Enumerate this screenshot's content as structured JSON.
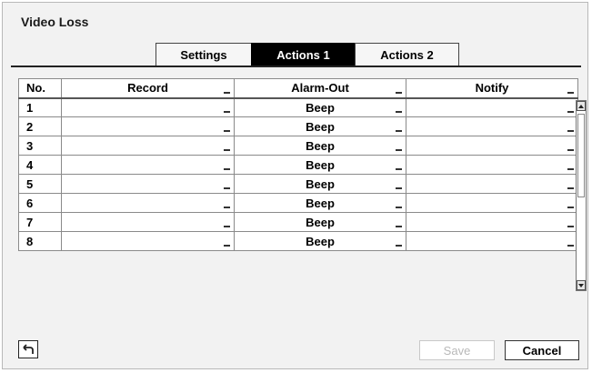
{
  "dialog": {
    "title": "Video Loss"
  },
  "tabs": [
    {
      "label": "Settings",
      "active": false
    },
    {
      "label": "Actions 1",
      "active": true
    },
    {
      "label": "Actions 2",
      "active": false
    }
  ],
  "table": {
    "columns": [
      "No.",
      "Record",
      "Alarm-Out",
      "Notify"
    ],
    "rows": [
      {
        "no": "1",
        "record": "",
        "alarm_out": "Beep",
        "notify": ""
      },
      {
        "no": "2",
        "record": "",
        "alarm_out": "Beep",
        "notify": ""
      },
      {
        "no": "3",
        "record": "",
        "alarm_out": "Beep",
        "notify": ""
      },
      {
        "no": "4",
        "record": "",
        "alarm_out": "Beep",
        "notify": ""
      },
      {
        "no": "5",
        "record": "",
        "alarm_out": "Beep",
        "notify": ""
      },
      {
        "no": "6",
        "record": "",
        "alarm_out": "Beep",
        "notify": ""
      },
      {
        "no": "7",
        "record": "",
        "alarm_out": "Beep",
        "notify": ""
      },
      {
        "no": "8",
        "record": "",
        "alarm_out": "Beep",
        "notify": ""
      }
    ]
  },
  "buttons": {
    "save_label": "Save",
    "save_enabled": false,
    "cancel_label": "Cancel"
  },
  "icons": {
    "back": "back-arrow-icon",
    "scroll_up": "scroll-up-icon",
    "scroll_down": "scroll-down-icon",
    "dropdown": "dropdown-indicator-icon"
  },
  "colors": {
    "active_tab_bg": "#000000",
    "disabled_text": "#b9b9b9",
    "panel_bg": "#f2f2f2"
  }
}
